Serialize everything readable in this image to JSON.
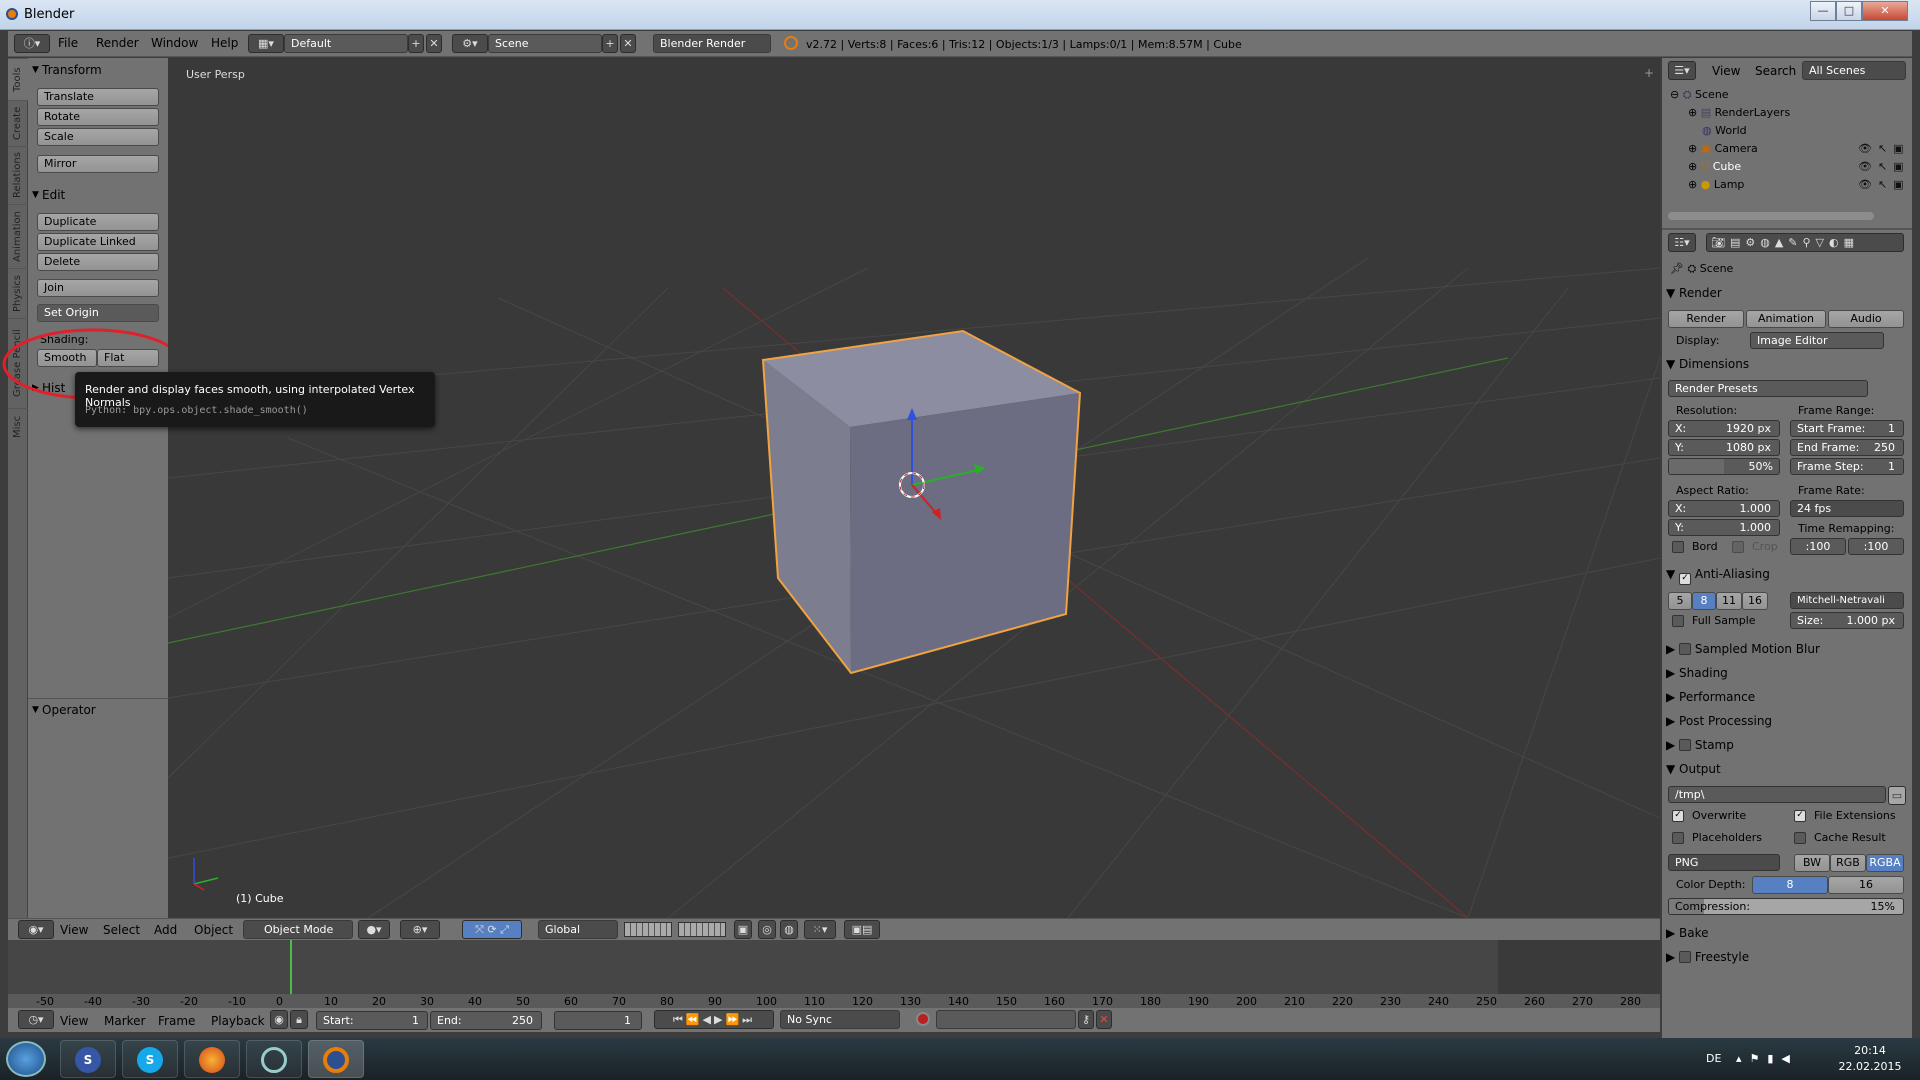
{
  "window": {
    "title": "Blender",
    "min": "—",
    "max": "□",
    "close": "✕"
  },
  "info_header": {
    "menus": [
      "File",
      "Render",
      "Window",
      "Help"
    ],
    "layout": "Default",
    "scene": "Scene",
    "engine": "Blender Render",
    "stats": "v2.72 | Verts:8 | Faces:6 | Tris:12 | Objects:1/3 | Lamps:0/1 | Mem:8.57M | Cube"
  },
  "tool_tabs": [
    "Tools",
    "Create",
    "Relations",
    "Animation",
    "Physics",
    "Grease Pencil",
    "Misc"
  ],
  "toolshelf": {
    "transform_title": "Transform",
    "translate": "Translate",
    "rotate": "Rotate",
    "scale": "Scale",
    "mirror": "Mirror",
    "edit_title": "Edit",
    "duplicate": "Duplicate",
    "duplicate_linked": "Duplicate Linked",
    "delete": "Delete",
    "join": "Join",
    "set_origin": "Set Origin",
    "shading_label": "Shading:",
    "smooth": "Smooth",
    "flat": "Flat",
    "history_title": "Hist",
    "operator_title": "Operator"
  },
  "tooltip": {
    "text": "Render and display faces smooth, using interpolated Vertex Normals",
    "python": "Python: bpy.ops.object.shade_smooth()"
  },
  "viewport": {
    "label": "User Persp",
    "object_label": "(1) Cube"
  },
  "vp_header": {
    "menus": [
      "View",
      "Select",
      "Add",
      "Object"
    ],
    "mode": "Object Mode",
    "orientation": "Global"
  },
  "timeline": {
    "ticks": [
      "-50",
      "-40",
      "-30",
      "-20",
      "-10",
      "0",
      "10",
      "20",
      "30",
      "40",
      "50",
      "60",
      "70",
      "80",
      "90",
      "100",
      "110",
      "120",
      "130",
      "140",
      "150",
      "160",
      "170",
      "180",
      "190",
      "200",
      "210",
      "220",
      "230",
      "240",
      "250",
      "260",
      "270",
      "280"
    ],
    "menus": [
      "View",
      "Marker",
      "Frame",
      "Playback"
    ],
    "start_label": "Start:",
    "start_value": "1",
    "end_label": "End:",
    "end_value": "250",
    "current": "1",
    "sync": "No Sync"
  },
  "outliner": {
    "view": "View",
    "search": "Search",
    "filter": "All Scenes",
    "items": [
      "Scene",
      "RenderLayers",
      "World",
      "Camera",
      "Cube",
      "Lamp"
    ]
  },
  "properties": {
    "context": "Scene",
    "render_title": "Render",
    "render_btn": "Render",
    "animation_btn": "Animation",
    "audio_btn": "Audio",
    "display_label": "Display:",
    "display_value": "Image Editor",
    "dimensions_title": "Dimensions",
    "render_presets": "Render Presets",
    "resolution_label": "Resolution:",
    "res_x": "X:",
    "res_x_val": "1920 px",
    "res_y": "Y:",
    "res_y_val": "1080 px",
    "res_pct": "50%",
    "frame_range_label": "Frame Range:",
    "start_frame": "Start Frame:",
    "start_frame_val": "1",
    "end_frame": "End Frame:",
    "end_frame_val": "250",
    "frame_step": "Frame Step:",
    "frame_step_val": "1",
    "aspect_label": "Aspect Ratio:",
    "asp_x": "X:",
    "asp_x_val": "1.000",
    "asp_y": "Y:",
    "asp_y_val": "1.000",
    "frame_rate_label": "Frame Rate:",
    "frame_rate": "24 fps",
    "time_remap_label": "Time Remapping:",
    "remap_old": ":100",
    "remap_new": ":100",
    "bord": "Bord",
    "crop": "Crop",
    "aa_title": "Anti-Aliasing",
    "aa_samples": [
      "5",
      "8",
      "11",
      "16"
    ],
    "aa_filter": "Mitchell-Netravali",
    "full_sample": "Full Sample",
    "size_label": "Size:",
    "size_val": "1.000 px",
    "motion_blur": "Sampled Motion Blur",
    "shading": "Shading",
    "performance": "Performance",
    "post_processing": "Post Processing",
    "stamp": "Stamp",
    "output_title": "Output",
    "output_path": "/tmp\\",
    "overwrite": "Overwrite",
    "file_extensions": "File Extensions",
    "placeholders": "Placeholders",
    "cache_result": "Cache Result",
    "format": "PNG",
    "bw": "BW",
    "rgb": "RGB",
    "rgba": "RGBA",
    "color_depth_label": "Color Depth:",
    "depth_8": "8",
    "depth_16": "16",
    "compression_label": "Compression:",
    "compression_val": "15%",
    "bake": "Bake",
    "freestyle": "Freestyle"
  },
  "taskbar": {
    "lang": "DE",
    "time": "20:14",
    "date": "22.02.2015"
  }
}
